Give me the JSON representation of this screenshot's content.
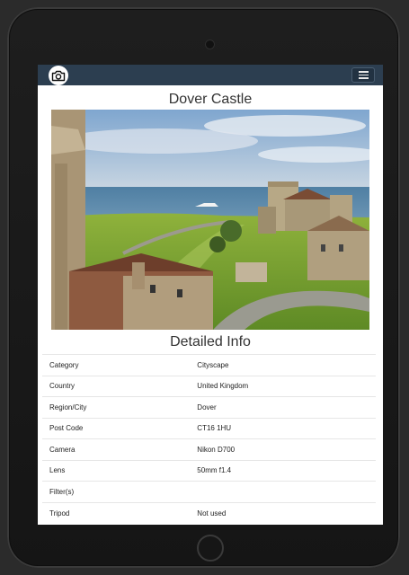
{
  "page": {
    "title": "Dover Castle",
    "section_title": "Detailed Info"
  },
  "navbar": {
    "logo_icon": "camera-icon",
    "menu_icon": "hamburger-icon",
    "bar_color": "#2c3e50"
  },
  "details": [
    {
      "label": "Category",
      "value": "Cityscape"
    },
    {
      "label": "Country",
      "value": "United Kingdom"
    },
    {
      "label": "Region/City",
      "value": "Dover"
    },
    {
      "label": "Post Code",
      "value": "CT16 1HU"
    },
    {
      "label": "Camera",
      "value": "Nikon D700"
    },
    {
      "label": "Lens",
      "value": "50mm f1.4"
    },
    {
      "label": "Filter(s)",
      "value": ""
    },
    {
      "label": "Tripod",
      "value": "Not used"
    }
  ]
}
